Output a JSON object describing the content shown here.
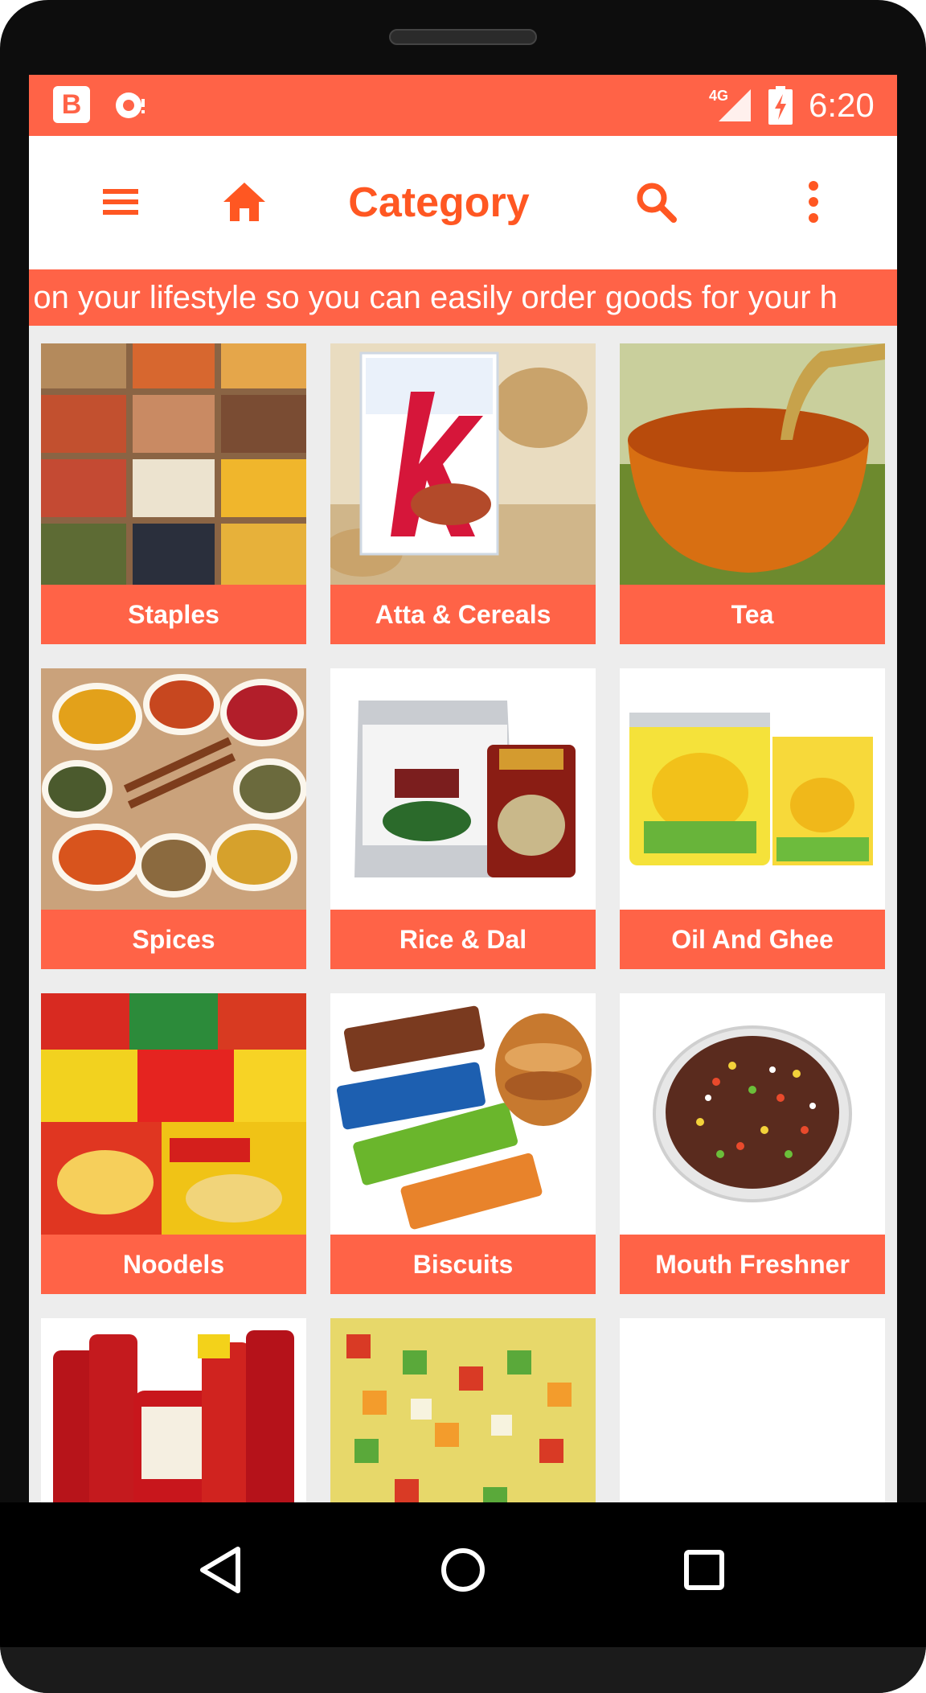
{
  "status_bar": {
    "app_badge": "B",
    "network": "4G",
    "time": "6:20",
    "background": "#ff6347"
  },
  "toolbar": {
    "title": "Category",
    "menu_icon": "hamburger-menu-icon",
    "home_icon": "home-icon",
    "search_icon": "search-icon",
    "more_icon": "more-vert-icon",
    "accent": "#ff5722"
  },
  "marquee": {
    "text": "d on your lifestyle so you can easily order goods for your h"
  },
  "categories": [
    {
      "label": "Staples"
    },
    {
      "label": "Atta & Cereals"
    },
    {
      "label": "Tea"
    },
    {
      "label": "Spices"
    },
    {
      "label": "Rice & Dal"
    },
    {
      "label": "Oil And Ghee"
    },
    {
      "label": "Noodels"
    },
    {
      "label": "Biscuits"
    },
    {
      "label": "Mouth Freshner"
    },
    {
      "label": ""
    },
    {
      "label": ""
    },
    {
      "label": ""
    }
  ],
  "nav_bar": {
    "back_icon": "back-triangle-icon",
    "home_icon": "home-circle-icon",
    "recents_icon": "recents-square-icon"
  }
}
